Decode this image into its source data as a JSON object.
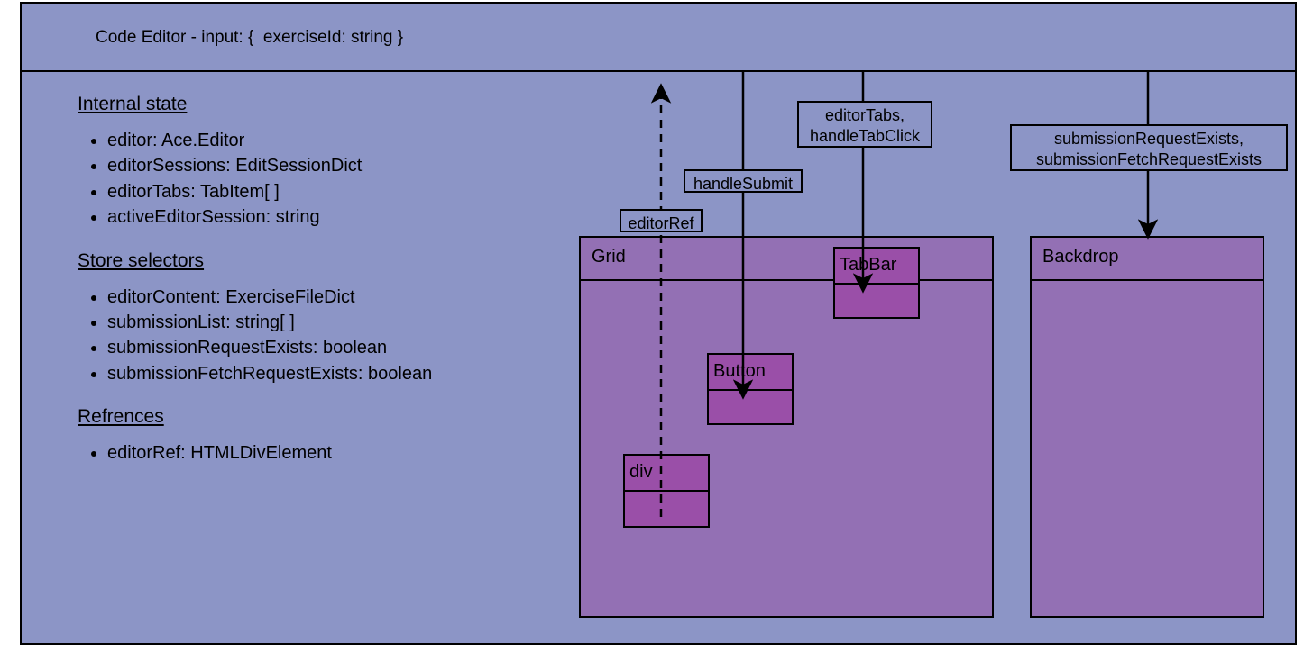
{
  "header": {
    "title": "Code Editor - input: {  exerciseId: string }"
  },
  "left_panel": {
    "sections": [
      {
        "heading": "Internal state",
        "items": [
          "editor: Ace.Editor",
          "editorSessions: EditSessionDict",
          "editorTabs: TabItem[ ]",
          "activeEditorSession: string"
        ]
      },
      {
        "heading": "Store selectors",
        "items": [
          "editorContent: ExerciseFileDict",
          "submissionList: string[ ]",
          "submissionRequestExists: boolean",
          "submissionFetchRequestExists: boolean"
        ]
      },
      {
        "heading": "Refrences",
        "items": [
          "editorRef: HTMLDivElement"
        ]
      }
    ]
  },
  "edge_labels": {
    "editor_ref": "editorRef",
    "handle_submit": "handleSubmit",
    "editor_tabs": "editorTabs,\nhandleTabClick",
    "submission_flags": "submissionRequestExists,\nsubmissionFetchRequestExists"
  },
  "components": {
    "grid": "Grid",
    "backdrop": "Backdrop",
    "tab_bar": "TabBar",
    "button": "Button",
    "div": "div"
  },
  "colors": {
    "component_bg": "#8c95c6",
    "child_bg": "#9370b4",
    "nested_bg": "#9a4fa8",
    "stroke": "#000000"
  }
}
